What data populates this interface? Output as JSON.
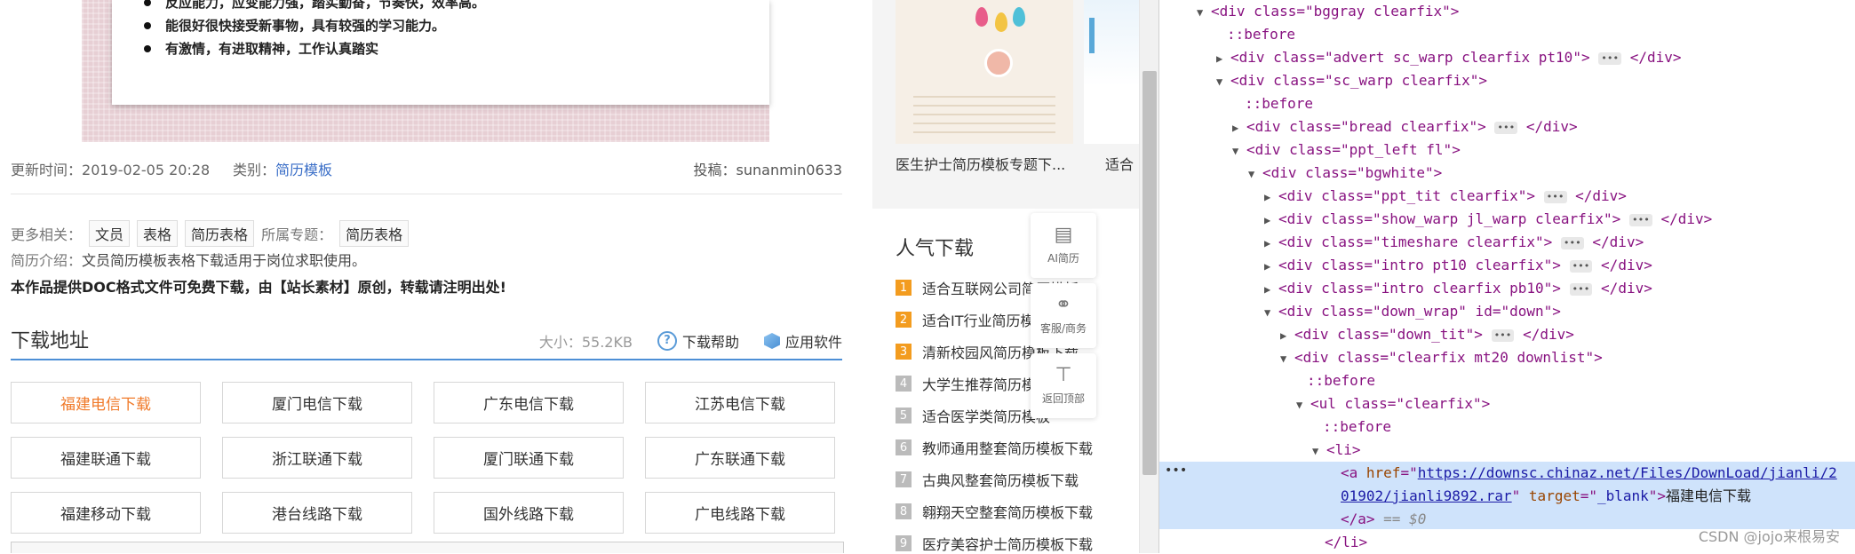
{
  "resume_preview": {
    "bullets": [
      "反应能力，应变能力强，踏实勤奋，节奏快，效率高。",
      "能很好很快接受新事物，具有较强的学习能力。",
      "有激情，有进取精神，工作认真踏实"
    ]
  },
  "meta": {
    "update_label": "更新时间：",
    "update_value": "2019-02-05 20:28",
    "category_label": "类别：",
    "category_value": "简历模板",
    "poster_label": "投稿：",
    "poster_value": "sunanmin0633"
  },
  "related": {
    "label": "更多相关：",
    "tags": [
      "文员",
      "表格",
      "简历表格"
    ],
    "topic_label": "所属专题：",
    "topic_tag": "简历表格"
  },
  "intro": {
    "label": "简历介绍：",
    "value": "文员简历模板表格下载适用于岗位求职使用。"
  },
  "notice": "本作品提供DOC格式文件可免费下载，由【站长素材】原创，转载请注明出处!",
  "download": {
    "title": "下载地址",
    "size": "大小：55.2KB",
    "help": "下载帮助",
    "software": "应用软件",
    "buttons": [
      "福建电信下载",
      "厦门电信下载",
      "广东电信下载",
      "江苏电信下载",
      "福建联通下载",
      "浙江联通下载",
      "厦门联通下载",
      "广东联通下载",
      "福建移动下载",
      "港台线路下载",
      "国外线路下载",
      "广电线路下载"
    ]
  },
  "sidebar": {
    "thumb_captions": [
      "医生护士简历模板专题下...",
      "适合"
    ],
    "popular_title": "人气下载",
    "popular": [
      {
        "rank": "1",
        "title": "适合互联网公司简历模板"
      },
      {
        "rank": "2",
        "title": "适合IT行业简历模板"
      },
      {
        "rank": "3",
        "title": "清新校园风简历模板下载"
      },
      {
        "rank": "4",
        "title": "大学生推荐简历模板"
      },
      {
        "rank": "5",
        "title": "适合医学类简历模板"
      },
      {
        "rank": "6",
        "title": "教师通用整套简历模板下载"
      },
      {
        "rank": "7",
        "title": "古典风整套简历模板下载"
      },
      {
        "rank": "8",
        "title": "翱翔天空整套简历模板下载"
      },
      {
        "rank": "9",
        "title": "医疗美容护士简历模板下载"
      }
    ],
    "float_tools": [
      {
        "icon": "resume-icon",
        "label": "AI简历"
      },
      {
        "icon": "headset-icon",
        "label": "客服/商务"
      },
      {
        "icon": "back-to-top-icon",
        "label": "返回顶部"
      }
    ]
  },
  "devtools": {
    "lines": [
      {
        "raw": "<div class=\"bggray clearfix\">"
      },
      {
        "raw": "::before"
      },
      {
        "raw": "<div class=\"advert sc_warp clearfix pt10\">"
      },
      {
        "raw": "<div class=\"sc_warp clearfix\">"
      },
      {
        "raw": "::before"
      },
      {
        "raw": "<div class=\"bread clearfix\">"
      },
      {
        "raw": "<div class=\"ppt_left fl\">"
      },
      {
        "raw": "<div class=\"bgwhite\">"
      },
      {
        "raw": "<div class=\"ppt_tit clearfix\">"
      },
      {
        "raw": "<div class=\"show_warp jl_warp clearfix\">"
      },
      {
        "raw": "<div class=\"timeshare clearfix\">"
      },
      {
        "raw": "<div class=\"intro pt10 clearfix\">"
      },
      {
        "raw": "<div class=\"intro clearfix pb10\">"
      },
      {
        "raw": "<div class=\"down_wrap\" id=\"down\">"
      },
      {
        "raw": "<div class=\"down_tit\">"
      },
      {
        "raw": "<div class=\"clearfix mt20 downlist\">"
      },
      {
        "raw": "::before"
      },
      {
        "raw": "<ul class=\"clearfix\">"
      },
      {
        "raw": "::before"
      },
      {
        "raw": "<li>"
      }
    ],
    "link_href": "https://downsc.chinaz.net/Files/DownLoad/jianli/201902/jianli9892.rar",
    "link_href_line1": "https://downsc.chinaz.net/Files/DownLoad/jianli/2",
    "link_href_line2": "01902/jianli9892.rar",
    "link_target": "_blank",
    "link_text": "福建电信下载",
    "eq0": "== $0",
    "close_li": "</li>",
    "close_a": "</a>"
  },
  "watermark": "CSDN @jojo来根易安"
}
